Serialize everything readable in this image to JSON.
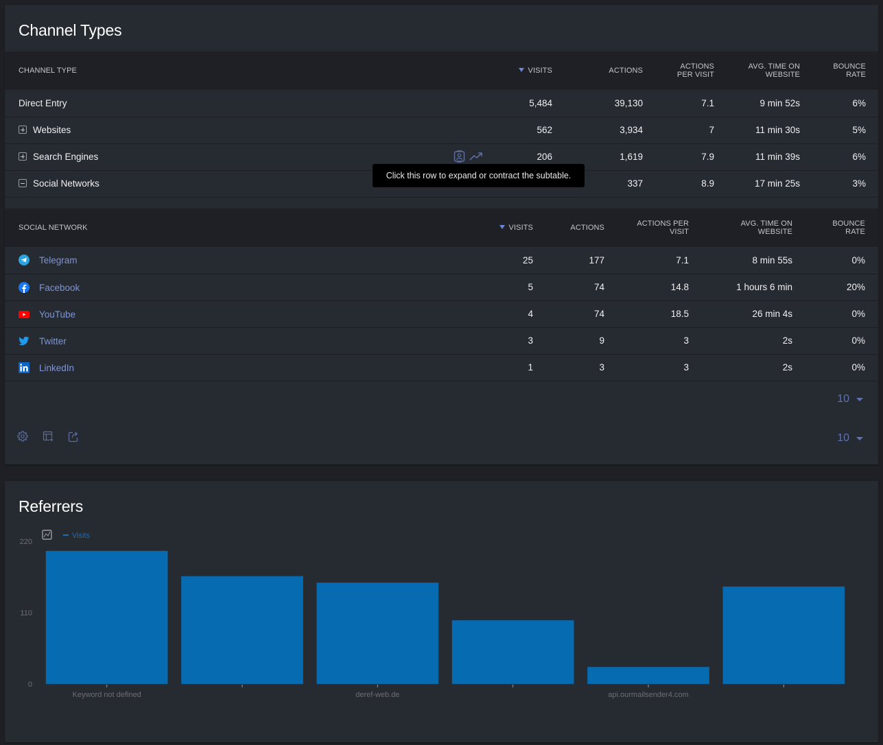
{
  "channel_types": {
    "title": "Channel Types",
    "columns": [
      "Channel Type",
      "Visits",
      "Actions",
      "Actions per Visit",
      "Avg. Time on Website",
      "Bounce Rate"
    ],
    "columns_display": {
      "label": "CHANNEL TYPE",
      "visits": "VISITS",
      "actions": "ACTIONS",
      "apv_line1": "ACTIONS",
      "apv_line2": "PER VISIT",
      "avg_line1": "AVG. TIME ON",
      "avg_line2": "WEBSITE",
      "bounce_line1": "BOUNCE",
      "bounce_line2": "RATE"
    },
    "sort_column": "visits",
    "sort_direction": "desc",
    "rows": [
      {
        "label": "Direct Entry",
        "expander": "none",
        "visits": "5,484",
        "actions": "39,130",
        "actions_per_visit": "7.1",
        "avg_time": "9 min 52s",
        "bounce_rate": "6%"
      },
      {
        "label": "Websites",
        "expander": "plus",
        "visits": "562",
        "actions": "3,934",
        "actions_per_visit": "7",
        "avg_time": "11 min 30s",
        "bounce_rate": "5%"
      },
      {
        "label": "Search Engines",
        "expander": "plus",
        "visits": "206",
        "actions": "1,619",
        "actions_per_visit": "7.9",
        "avg_time": "11 min 39s",
        "bounce_rate": "6%",
        "row_action_icons": [
          "visitor-profile-icon",
          "row-evolution-icon"
        ]
      },
      {
        "label": "Social Networks",
        "expander": "minus",
        "visits": "",
        "actions": "337",
        "actions_per_visit": "8.9",
        "avg_time": "17 min 25s",
        "bounce_rate": "3%"
      }
    ],
    "tooltip": "Click this row to expand or contract the subtable.",
    "subtable": {
      "columns_display": {
        "label": "SOCIAL NETWORK",
        "visits": "VISITS",
        "actions": "ACTIONS",
        "apv_line1": "ACTIONS PER",
        "apv_line2": "VISIT",
        "avg_line1": "AVG. TIME ON",
        "avg_line2": "WEBSITE",
        "bounce_line1": "BOUNCE",
        "bounce_line2": "RATE"
      },
      "rows": [
        {
          "label": "Telegram",
          "icon": "telegram-icon",
          "visits": "25",
          "actions": "177",
          "actions_per_visit": "7.1",
          "avg_time": "8 min 55s",
          "bounce_rate": "0%"
        },
        {
          "label": "Facebook",
          "icon": "facebook-icon",
          "visits": "5",
          "actions": "74",
          "actions_per_visit": "14.8",
          "avg_time": "1 hours 6 min",
          "bounce_rate": "20%"
        },
        {
          "label": "YouTube",
          "icon": "youtube-icon",
          "visits": "4",
          "actions": "74",
          "actions_per_visit": "18.5",
          "avg_time": "26 min 4s",
          "bounce_rate": "0%"
        },
        {
          "label": "Twitter",
          "icon": "twitter-icon",
          "visits": "3",
          "actions": "9",
          "actions_per_visit": "3",
          "avg_time": "2s",
          "bounce_rate": "0%"
        },
        {
          "label": "LinkedIn",
          "icon": "linkedin-icon",
          "visits": "1",
          "actions": "3",
          "actions_per_visit": "3",
          "avg_time": "2s",
          "bounce_rate": "0%"
        }
      ],
      "limit": "10"
    },
    "limit": "10",
    "footer_icons": [
      "gear-icon",
      "table-add-icon",
      "export-icon"
    ]
  },
  "referrers": {
    "title": "Referrers",
    "chart_data": {
      "type": "bar",
      "title": "",
      "xlabel": "",
      "ylabel": "",
      "ylim": [
        0,
        220
      ],
      "yticks": [
        0,
        110,
        220
      ],
      "legend": [
        "Visits"
      ],
      "legend_placement": "top-left",
      "grid": false,
      "categories": [
        "Keyword not defined",
        "",
        "deref-web.de",
        "",
        "api.ourmailsender4.com",
        ""
      ],
      "series": [
        {
          "name": "Visits",
          "values": [
            205,
            166,
            156,
            98,
            26,
            150
          ]
        }
      ],
      "colors": {
        "bar": "#066bb0",
        "legend": "#1c6db2",
        "axis_text": "#6c6f75"
      }
    }
  },
  "colors": {
    "page_bg": "#1e2025",
    "card_bg": "#262a31",
    "header_bg": "#1e2025",
    "link": "#7f95d6",
    "accent": "#6f86d6",
    "tooltip_bg": "#000000"
  }
}
